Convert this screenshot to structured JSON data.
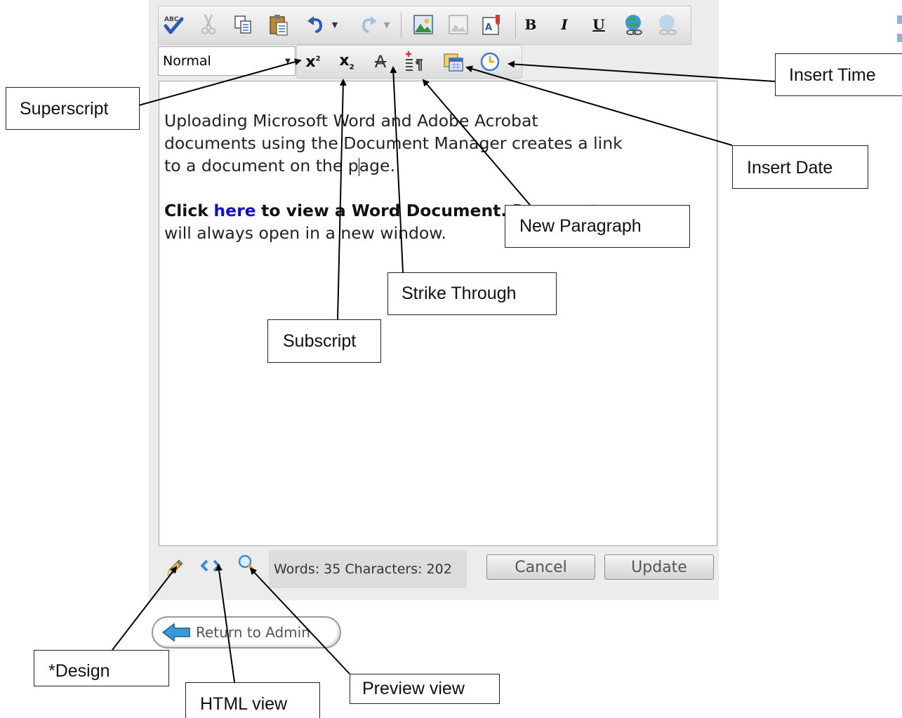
{
  "toolbar": {
    "format_value": "Normal",
    "row1_icons": [
      "spellcheck-icon",
      "cut-icon",
      "copy-icon",
      "paste-icon",
      "undo-icon",
      "redo-icon",
      "image-icon",
      "image-map-icon",
      "insert-document-icon",
      "bold-icon",
      "italic-icon",
      "underline-icon",
      "link-icon",
      "unlink-icon"
    ],
    "bold_glyph": "B",
    "italic_glyph": "I",
    "underline_glyph": "U",
    "superscript_glyph": "x",
    "subscript_glyph": "x",
    "strike_glyph": "A"
  },
  "content": {
    "paragraph1_lines": [
      "Uploading Microsoft Word and Adobe Acrobat",
      "documents using the Document Manager creates a link"
    ],
    "paragraph1_line3_before_caret": "to a document on the p",
    "paragraph1_line3_after_caret": "age.",
    "click_word": "Click",
    "link_text": "here",
    "link_after": "to view a Word Document.",
    "link_trailing": "Documents",
    "line_after": "will always open in a new window."
  },
  "status": {
    "counts": "Words: 35 Characters: 202"
  },
  "buttons": {
    "cancel": "Cancel",
    "update": "Update",
    "return_to_admin": "Return to Admin"
  },
  "callouts": {
    "superscript": "Superscript",
    "insert_time": "Insert Time",
    "insert_date": "Insert Date",
    "new_paragraph": "New Paragraph",
    "strike_through": "Strike Through",
    "subscript": "Subscript",
    "design": "*Design",
    "html_view": "HTML view",
    "preview_view": "Preview view"
  },
  "colors": {
    "link": "#1010cc",
    "toolbar_bg": "#e4e4e4",
    "editor_bg": "#ececec"
  }
}
